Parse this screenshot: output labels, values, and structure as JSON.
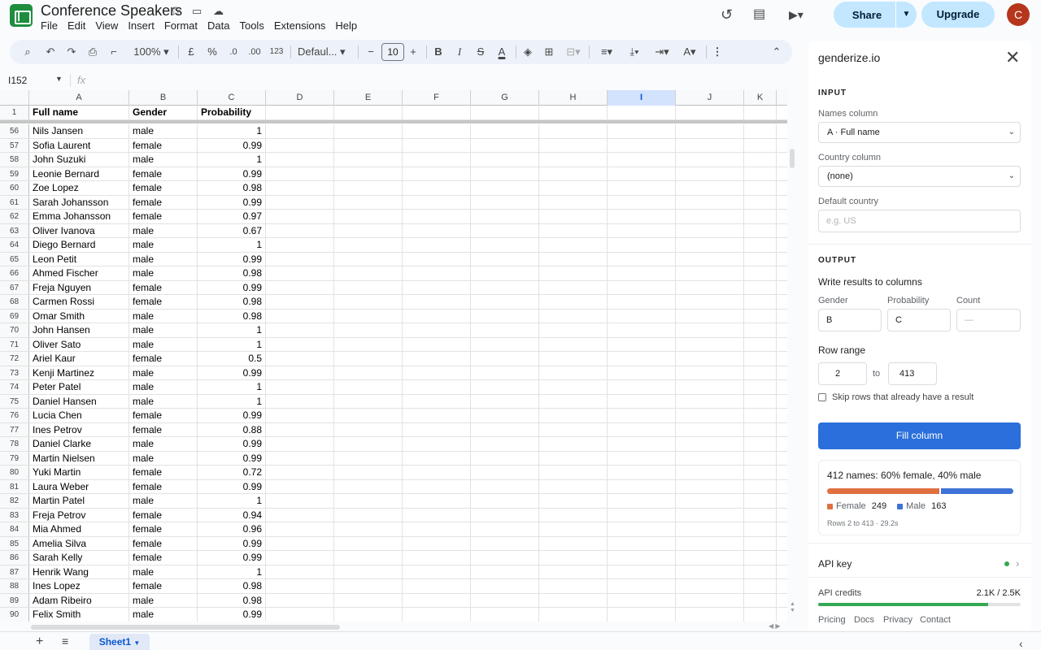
{
  "header": {
    "title": "Conference Speakers",
    "menu": [
      "File",
      "Edit",
      "View",
      "Insert",
      "Format",
      "Data",
      "Tools",
      "Extensions",
      "Help"
    ],
    "share_label": "Share",
    "upgrade_label": "Upgrade",
    "avatar_initial": "C"
  },
  "toolbar": {
    "zoom": "100%",
    "currency": "£",
    "percent": "%",
    "dec_decrease": ".0",
    "dec_increase": ".00",
    "number_format": "123",
    "font": "Defaul...",
    "font_size": "10"
  },
  "formula_bar": {
    "cell_ref": "I152",
    "fx": "fx"
  },
  "grid": {
    "columns": [
      "A",
      "B",
      "C",
      "D",
      "E",
      "F",
      "G",
      "H",
      "I",
      "J",
      "K"
    ],
    "selected_column": "I",
    "header_row": {
      "num": "1",
      "full_name": "Full name",
      "gender": "Gender",
      "probability": "Probability"
    },
    "rows": [
      [
        "56",
        "Nils Jansen",
        "male",
        "1"
      ],
      [
        "57",
        "Sofia Laurent",
        "female",
        "0.99"
      ],
      [
        "58",
        "John Suzuki",
        "male",
        "1"
      ],
      [
        "59",
        "Leonie Bernard",
        "female",
        "0.99"
      ],
      [
        "60",
        "Zoe Lopez",
        "female",
        "0.98"
      ],
      [
        "61",
        "Sarah Johansson",
        "female",
        "0.99"
      ],
      [
        "62",
        "Emma Johansson",
        "female",
        "0.97"
      ],
      [
        "63",
        "Oliver Ivanova",
        "male",
        "0.67"
      ],
      [
        "64",
        "Diego Bernard",
        "male",
        "1"
      ],
      [
        "65",
        "Leon Petit",
        "male",
        "0.99"
      ],
      [
        "66",
        "Ahmed Fischer",
        "male",
        "0.98"
      ],
      [
        "67",
        "Freja Nguyen",
        "female",
        "0.99"
      ],
      [
        "68",
        "Carmen Rossi",
        "female",
        "0.98"
      ],
      [
        "69",
        "Omar Smith",
        "male",
        "0.98"
      ],
      [
        "70",
        "John Hansen",
        "male",
        "1"
      ],
      [
        "71",
        "Oliver Sato",
        "male",
        "1"
      ],
      [
        "72",
        "Ariel Kaur",
        "female",
        "0.5"
      ],
      [
        "73",
        "Kenji Martinez",
        "male",
        "0.99"
      ],
      [
        "74",
        "Peter Patel",
        "male",
        "1"
      ],
      [
        "75",
        "Daniel Hansen",
        "male",
        "1"
      ],
      [
        "76",
        "Lucia Chen",
        "female",
        "0.99"
      ],
      [
        "77",
        "Ines Petrov",
        "female",
        "0.88"
      ],
      [
        "78",
        "Daniel Clarke",
        "male",
        "0.99"
      ],
      [
        "79",
        "Martin Nielsen",
        "male",
        "0.99"
      ],
      [
        "80",
        "Yuki Martin",
        "female",
        "0.72"
      ],
      [
        "81",
        "Laura Weber",
        "female",
        "0.99"
      ],
      [
        "82",
        "Martin Patel",
        "male",
        "1"
      ],
      [
        "83",
        "Freja Petrov",
        "female",
        "0.94"
      ],
      [
        "84",
        "Mia Ahmed",
        "female",
        "0.96"
      ],
      [
        "85",
        "Amelia Silva",
        "female",
        "0.99"
      ],
      [
        "86",
        "Sarah Kelly",
        "female",
        "0.99"
      ],
      [
        "87",
        "Henrik Wang",
        "male",
        "1"
      ],
      [
        "88",
        "Ines Lopez",
        "female",
        "0.98"
      ],
      [
        "89",
        "Adam Ribeiro",
        "male",
        "0.98"
      ],
      [
        "90",
        "Felix Smith",
        "male",
        "0.99"
      ]
    ]
  },
  "panel": {
    "title": "genderize.io",
    "input_section": "INPUT",
    "names_column_label": "Names column",
    "names_column_value": "A · Full name",
    "country_column_label": "Country column",
    "country_column_value": "(none)",
    "default_country_label": "Default country",
    "default_country_placeholder": "e.g. US",
    "output_section": "OUTPUT",
    "write_results_label": "Write results to columns",
    "gender_label": "Gender",
    "gender_value": "B",
    "probability_label": "Probability",
    "probability_value": "C",
    "count_label": "Count",
    "count_placeholder": "—",
    "row_range_label": "Row range",
    "row_from": "2",
    "row_to_word": "to",
    "row_to": "413",
    "skip_label": "Skip rows that already have a result",
    "fill_button": "Fill column",
    "summary_title": "412 names: 60% female, 40% male",
    "female_fraction": 0.604,
    "female_label": "Female",
    "female_count": "249",
    "male_label": "Male",
    "male_count": "163",
    "summary_meta": "Rows 2 to 413 · 29.2s",
    "api_key_label": "API key",
    "api_credits_label": "API credits",
    "api_credits_value": "2.1K / 2.5K",
    "credits_fraction": 0.84,
    "links": [
      "Pricing",
      "Docs",
      "Privacy",
      "Contact"
    ]
  },
  "sheets": {
    "active": "Sheet1"
  },
  "colors": {
    "female": "#e07040",
    "male": "#3d72d7",
    "primary": "#2a6fdb",
    "credits": "#34a853"
  }
}
